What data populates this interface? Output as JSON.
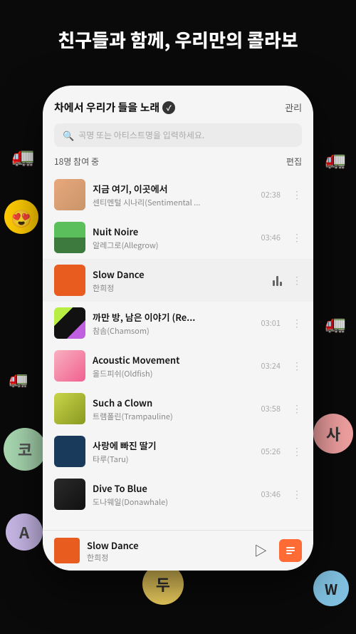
{
  "headline": {
    "line1": "친구들과 함께, 우리만의 콜라보"
  },
  "stickers": {
    "truck": "🚛",
    "emoji_face": "😍",
    "ko": "코",
    "sa": "사",
    "a": "A",
    "du": "두",
    "w": "W"
  },
  "playlist": {
    "title": "차에서 우리가 들을 노래",
    "manage_label": "관리",
    "search_placeholder": "곡명 또는 아티스트명을 입력하세요.",
    "participants_label": "18명 참여 중",
    "edit_label": "편집",
    "songs": [
      {
        "name": "지금 여기, 이곳에서",
        "artist": "센티멘털 시나리(Sentimental ...",
        "duration": "02:38",
        "thumb_class": "thumb-1",
        "playing": false
      },
      {
        "name": "Nuit Noire",
        "artist": "알레그로(Allegrow)",
        "duration": "03:46",
        "thumb_class": "thumb-2",
        "playing": false
      },
      {
        "name": "Slow Dance",
        "artist": "한희정",
        "duration": "",
        "thumb_class": "thumb-3",
        "playing": true
      },
      {
        "name": "까만 방, 남은 이야기 (Re...",
        "artist": "참솜(Chamsom)",
        "duration": "03:01",
        "thumb_class": "thumb-4",
        "playing": false
      },
      {
        "name": "Acoustic Movement",
        "artist": "올드피쉬(Oldfish)",
        "duration": "03:24",
        "thumb_class": "thumb-5",
        "playing": false
      },
      {
        "name": "Such a Clown",
        "artist": "트램폴린(Trampauline)",
        "duration": "03:58",
        "thumb_class": "thumb-6",
        "playing": false
      },
      {
        "name": "사랑에 빠진 딸기",
        "artist": "타루(Taru)",
        "duration": "05:26",
        "thumb_class": "thumb-7",
        "playing": false
      },
      {
        "name": "Dive To Blue",
        "artist": "도나웨일(Donawhale)",
        "duration": "03:46",
        "thumb_class": "thumb-8",
        "playing": false
      }
    ],
    "now_playing": {
      "name": "Slow Dance",
      "artist": "한희정"
    }
  }
}
